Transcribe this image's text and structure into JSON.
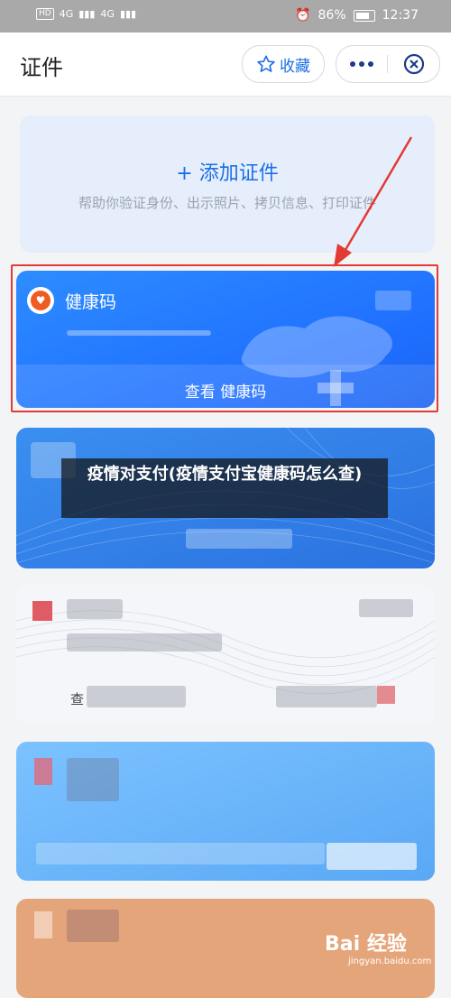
{
  "status_bar": {
    "hd": "HD",
    "signal_1": "4G",
    "signal_2": "4G",
    "battery": "86%",
    "time": "12:37"
  },
  "header": {
    "title": "证件",
    "favorite_label": "收藏"
  },
  "add_card": {
    "title": "+ 添加证件",
    "subtitle": "帮助你验证身份、出示照片、拷贝信息、打印证件"
  },
  "health_card": {
    "title": "健康码",
    "footer": "查看   健康码"
  },
  "caption": {
    "text": "疫情对支付(疫情支付宝健康码怎么查)"
  },
  "white_card": {
    "look_label": "查"
  },
  "watermark": {
    "text": "Bai 经验",
    "sub": "jingyan.baidu.com"
  }
}
